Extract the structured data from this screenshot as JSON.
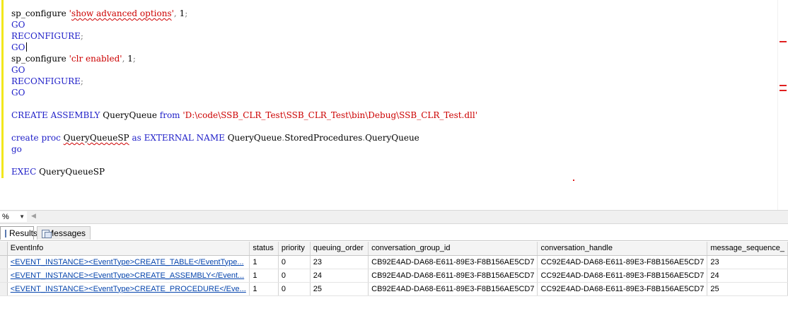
{
  "editor": {
    "lines": [
      [
        {
          "t": "sp_configure ",
          "c": "pl"
        },
        {
          "t": "'",
          "c": "str"
        },
        {
          "t": "show advanced options",
          "c": "str",
          "sq": true
        },
        {
          "t": "'",
          "c": "str"
        },
        {
          "t": ", ",
          "c": "gray"
        },
        {
          "t": "1",
          "c": "pl"
        },
        {
          "t": ";",
          "c": "gray"
        }
      ],
      [
        {
          "t": "GO",
          "c": "kw"
        }
      ],
      [
        {
          "t": "RECONFIGURE",
          "c": "kw"
        },
        {
          "t": ";",
          "c": "gray"
        }
      ],
      [
        {
          "t": "GO",
          "c": "kw"
        },
        {
          "caret": true
        }
      ],
      [
        {
          "t": "sp_configure ",
          "c": "pl"
        },
        {
          "t": "'clr enabled'",
          "c": "str"
        },
        {
          "t": ", ",
          "c": "gray"
        },
        {
          "t": "1",
          "c": "pl"
        },
        {
          "t": ";",
          "c": "gray"
        }
      ],
      [
        {
          "t": "GO",
          "c": "kw"
        }
      ],
      [
        {
          "t": "RECONFIGURE",
          "c": "kw"
        },
        {
          "t": ";",
          "c": "gray"
        }
      ],
      [
        {
          "t": "GO",
          "c": "kw"
        }
      ],
      [],
      [
        {
          "t": "CREATE ASSEMBLY",
          "c": "kw"
        },
        {
          "t": " QueryQueue ",
          "c": "pl"
        },
        {
          "t": "from",
          "c": "kw"
        },
        {
          "t": " ",
          "c": "pl"
        },
        {
          "t": "'D:\\code\\SSB_CLR_Test\\SSB_CLR_Test\\bin\\Debug\\SSB_CLR_Test.dll'",
          "c": "str"
        }
      ],
      [],
      [
        {
          "t": "create proc",
          "c": "kw"
        },
        {
          "t": " ",
          "c": "pl"
        },
        {
          "t": "QueryQueueSP",
          "c": "pl",
          "sq": true
        },
        {
          "t": " ",
          "c": "pl"
        },
        {
          "t": "as",
          "c": "kw"
        },
        {
          "t": " ",
          "c": "pl"
        },
        {
          "t": "EXTERNAL NAME",
          "c": "kw"
        },
        {
          "t": " QueryQueue",
          "c": "pl"
        },
        {
          "t": ".",
          "c": "gray"
        },
        {
          "t": "StoredProcedures",
          "c": "pl"
        },
        {
          "t": ".",
          "c": "gray"
        },
        {
          "t": "QueryQueue",
          "c": "pl"
        }
      ],
      [
        {
          "t": "go",
          "c": "kw"
        }
      ],
      [],
      [
        {
          "t": "EXEC",
          "c": "kw"
        },
        {
          "t": " QueryQueueSP",
          "c": "pl"
        }
      ]
    ]
  },
  "zoom": {
    "value": "%"
  },
  "tabs": {
    "results": "Results",
    "messages": "Messages"
  },
  "grid": {
    "columns": [
      "EventInfo",
      "status",
      "priority",
      "queuing_order",
      "conversation_group_id",
      "conversation_handle",
      "message_sequence_"
    ],
    "rows": [
      [
        "<EVENT_INSTANCE><EventType>CREATE_TABLE</EventType...",
        "1",
        "0",
        "23",
        "CB92E4AD-DA68-E611-89E3-F8B156AE5CD7",
        "CC92E4AD-DA68-E611-89E3-F8B156AE5CD7",
        "23"
      ],
      [
        "<EVENT_INSTANCE><EventType>CREATE_ASSEMBLY</Event...",
        "1",
        "0",
        "24",
        "CB92E4AD-DA68-E611-89E3-F8B156AE5CD7",
        "CC92E4AD-DA68-E611-89E3-F8B156AE5CD7",
        "24"
      ],
      [
        "<EVENT_INSTANCE><EventType>CREATE_PROCEDURE</Eve...",
        "1",
        "0",
        "25",
        "CB92E4AD-DA68-E611-89E3-F8B156AE5CD7",
        "CC92E4AD-DA68-E611-89E3-F8B156AE5CD7",
        "25"
      ]
    ]
  }
}
